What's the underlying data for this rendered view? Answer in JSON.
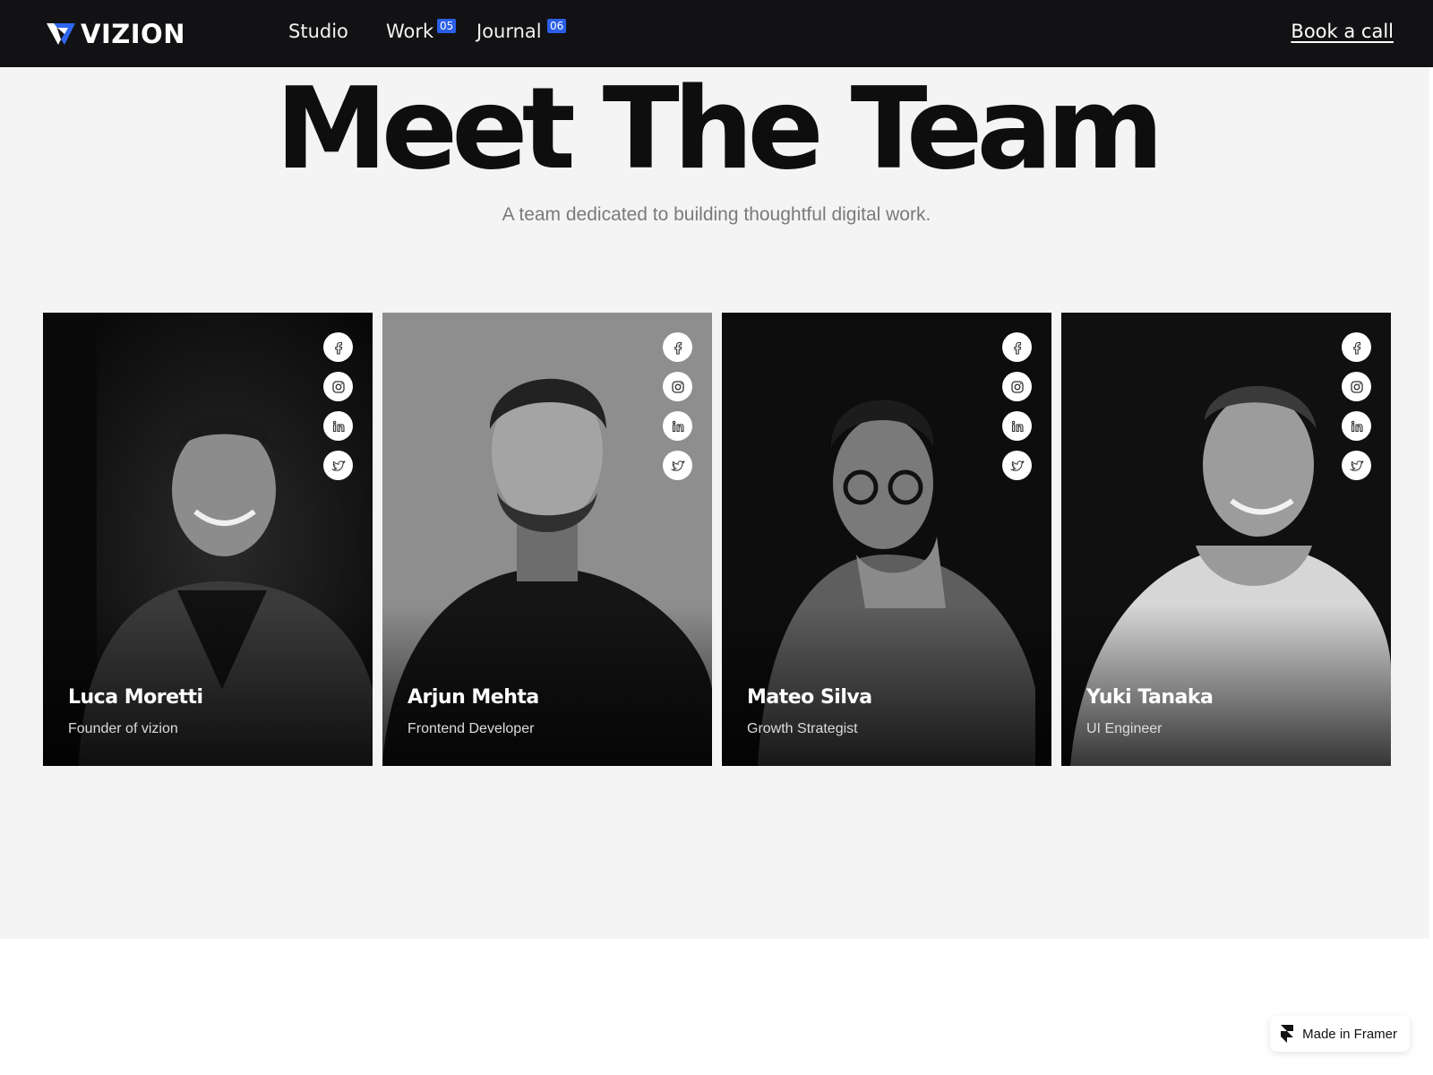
{
  "nav": {
    "brand": "VIZION",
    "links": [
      {
        "label": "Studio",
        "badge": ""
      },
      {
        "label": "Work",
        "badge": "05"
      },
      {
        "label": "Journal",
        "badge": "06"
      }
    ],
    "cta": "Book a call"
  },
  "hero": {
    "title": "Meet The Team",
    "subtitle": "A team dedicated to building thoughtful digital work."
  },
  "team": [
    {
      "name": "Luca Moretti",
      "role": "Founder of vizion"
    },
    {
      "name": "Arjun Mehta",
      "role": "Frontend Developer"
    },
    {
      "name": "Mateo Silva",
      "role": "Growth Strategist"
    },
    {
      "name": "Yuki Tanaka",
      "role": "UI Engineer"
    }
  ],
  "social_icons": [
    "facebook-icon",
    "instagram-icon",
    "linkedin-icon",
    "twitter-icon"
  ],
  "footer": {
    "made_in": "Made in Framer"
  },
  "colors": {
    "nav_bg": "#121214",
    "page_bg": "#f4f4f4",
    "badge": "#2b5fe6"
  }
}
